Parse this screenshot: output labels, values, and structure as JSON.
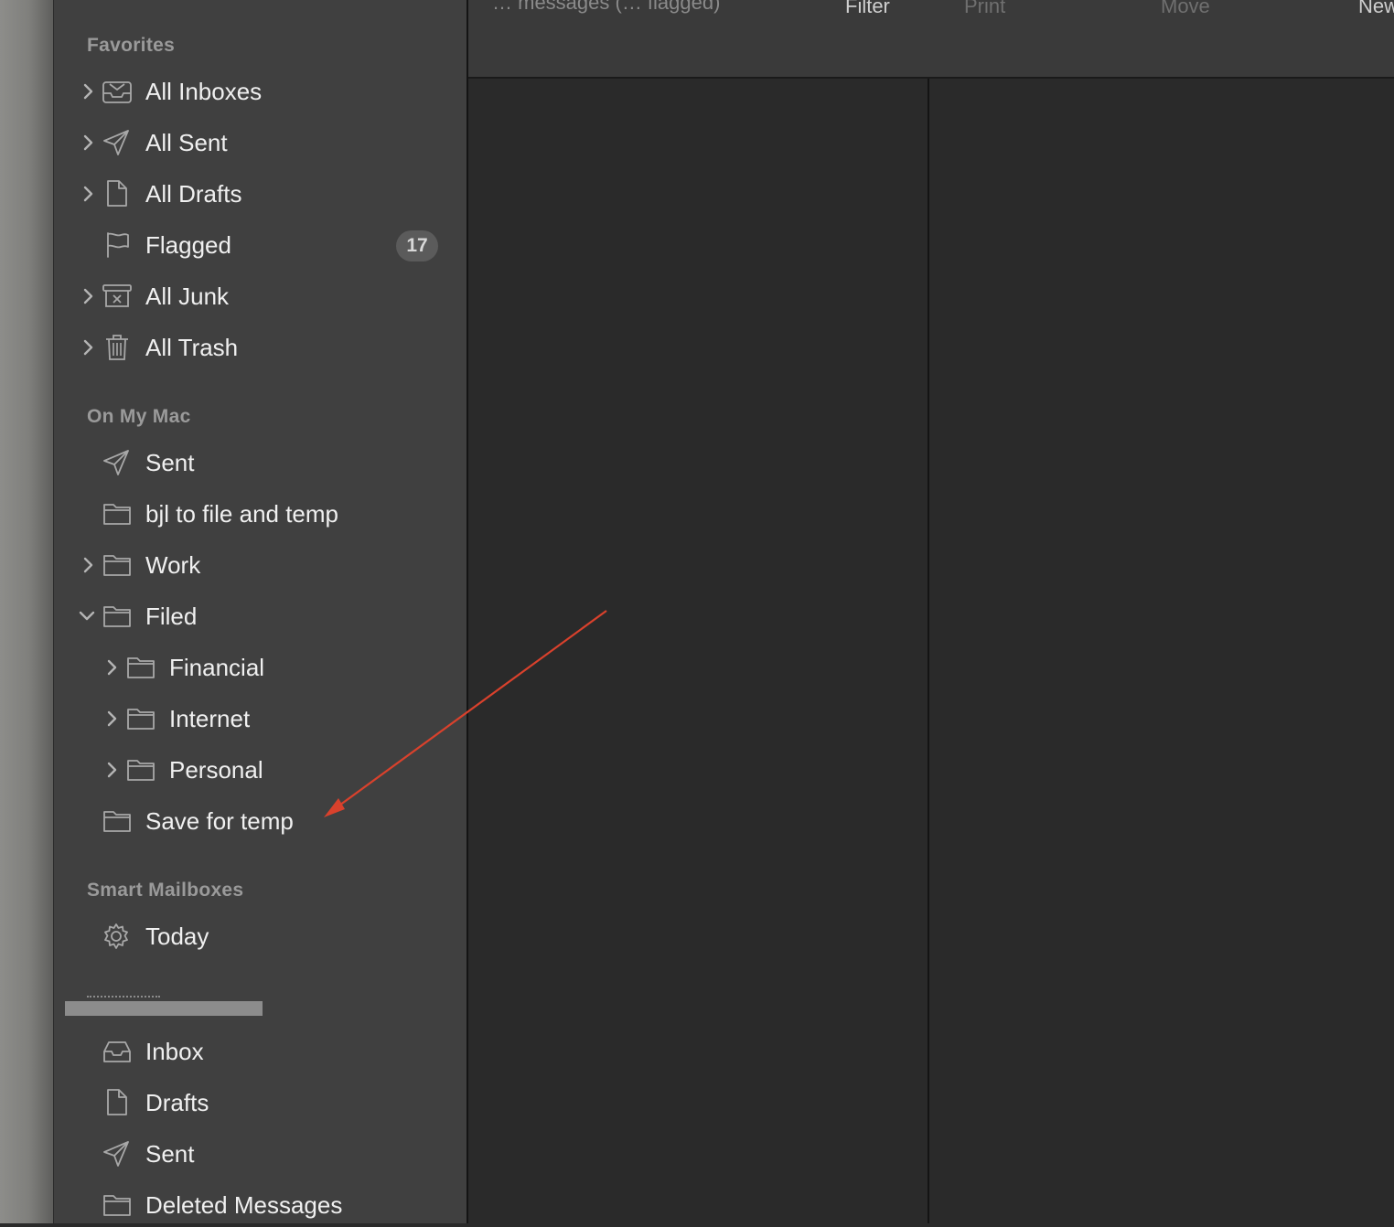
{
  "toolbar": {
    "subtitle": "… messages (… flagged)",
    "buttons": [
      {
        "label": "Filter",
        "enabled": true
      },
      {
        "label": "Print",
        "enabled": false
      },
      {
        "label": "Move",
        "enabled": false
      },
      {
        "label": "New",
        "enabled": true
      }
    ]
  },
  "colors": {
    "annotation_arrow": "#d9412c",
    "sidebar_bg": "#404040",
    "content_bg": "#2a2a2a"
  },
  "sidebar": {
    "favorites": {
      "header": "Favorites",
      "items": [
        {
          "label": "All Inboxes",
          "icon": "inbox-tray-icon",
          "expandable": true
        },
        {
          "label": "All Sent",
          "icon": "paper-plane-icon",
          "expandable": true
        },
        {
          "label": "All Drafts",
          "icon": "document-icon",
          "expandable": true
        },
        {
          "label": "Flagged",
          "icon": "flag-icon",
          "expandable": false,
          "badge": "17"
        },
        {
          "label": "All Junk",
          "icon": "junk-bin-icon",
          "expandable": true
        },
        {
          "label": "All Trash",
          "icon": "trash-icon",
          "expandable": true
        }
      ]
    },
    "on_my_mac": {
      "header": "On My Mac",
      "items": [
        {
          "label": "Sent",
          "icon": "paper-plane-icon",
          "expandable": false
        },
        {
          "label": "bjl to file and temp",
          "icon": "folder-icon",
          "expandable": false
        },
        {
          "label": "Work",
          "icon": "folder-icon",
          "expandable": true
        },
        {
          "label": "Filed",
          "icon": "folder-icon",
          "expandable": true,
          "expanded": true
        },
        {
          "label": "Financial",
          "icon": "folder-icon",
          "expandable": true,
          "level": 1
        },
        {
          "label": "Internet",
          "icon": "folder-icon",
          "expandable": true,
          "level": 1
        },
        {
          "label": "Personal",
          "icon": "folder-icon",
          "expandable": true,
          "level": 1
        },
        {
          "label": "Save for temp",
          "icon": "folder-icon",
          "expandable": false
        }
      ]
    },
    "smart_mailboxes": {
      "header": "Smart Mailboxes",
      "items": [
        {
          "label": "Today",
          "icon": "gear-icon",
          "expandable": false
        }
      ]
    },
    "account": {
      "items": [
        {
          "label": "Inbox",
          "icon": "inbox-tray-icon",
          "expandable": false
        },
        {
          "label": "Drafts",
          "icon": "document-icon",
          "expandable": false
        },
        {
          "label": "Sent",
          "icon": "paper-plane-icon",
          "expandable": false
        },
        {
          "label": "Deleted Messages",
          "icon": "folder-icon",
          "expandable": false
        }
      ]
    }
  }
}
